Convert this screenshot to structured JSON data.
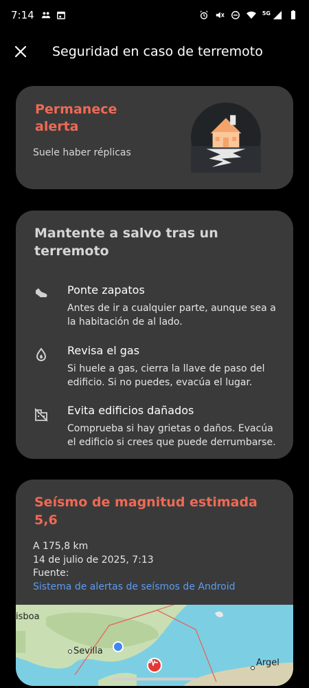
{
  "status_bar": {
    "time": "7:14",
    "network": "5G"
  },
  "app_bar": {
    "title": "Seguridad en caso de terremoto",
    "close_icon": "close-icon"
  },
  "alert_card": {
    "title": "Permanece alerta",
    "subtitle": "Suele haber réplicas",
    "illustration": "house-on-cracked-ground"
  },
  "safety_card": {
    "title": "Mantente a salvo tras un terremoto",
    "tips": [
      {
        "icon": "shoe-icon",
        "title": "Ponte zapatos",
        "text": "Antes de ir a cualquier parte, aunque sea a la habitación de al lado."
      },
      {
        "icon": "gas-drop-icon",
        "title": "Revisa el gas",
        "text": "Si huele a gas, cierra la llave de paso del edificio. Si no puedes, evacúa el lugar."
      },
      {
        "icon": "damaged-building-icon",
        "title": "Evita edificios dañados",
        "text": "Comprueba si hay grietas o daños. Evacúa el edificio si crees que puede derrumbarse."
      }
    ]
  },
  "quake_card": {
    "title": "Seísmo de magnitud estimada 5,6",
    "distance": "A 175,8 km",
    "datetime": "14 de julio de 2025, 7:13",
    "source_label": "Fuente:",
    "source_link": "Sistema de alertas de seísmos de Android",
    "map": {
      "labels": [
        "isboa",
        "Sevilla",
        "Argel"
      ]
    }
  },
  "colors": {
    "accent": "#ee6a55",
    "card_bg": "#3a3a3a",
    "link": "#5b9cf2"
  }
}
